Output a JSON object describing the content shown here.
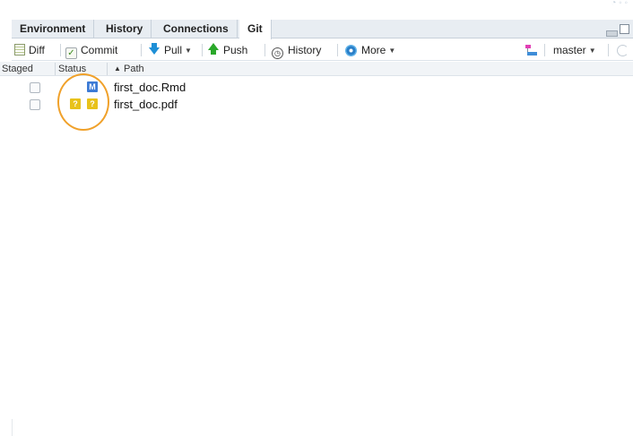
{
  "tabs": [
    {
      "label": "Environment",
      "active": false
    },
    {
      "label": "History",
      "active": false
    },
    {
      "label": "Connections",
      "active": false
    },
    {
      "label": "Git",
      "active": true
    }
  ],
  "toolbar": {
    "diff_label": "Diff",
    "commit_label": "Commit",
    "pull_label": "Pull",
    "push_label": "Push",
    "history_label": "History",
    "more_label": "More",
    "branch_label": "master"
  },
  "columns": {
    "staged": "Staged",
    "status": "Status",
    "path": "Path",
    "sort_indicator": "▲"
  },
  "files": [
    {
      "path": "first_doc.Rmd",
      "staged": false,
      "index_status": "",
      "worktree_status": "M"
    },
    {
      "path": "first_doc.pdf",
      "staged": false,
      "index_status": "?",
      "worktree_status": "?"
    }
  ],
  "colors": {
    "modified_badge": "#3d7bd5",
    "untracked_badge": "#e8c21a",
    "highlight_ring": "#f0a12a",
    "tabbar_bg": "#e8edf2"
  }
}
